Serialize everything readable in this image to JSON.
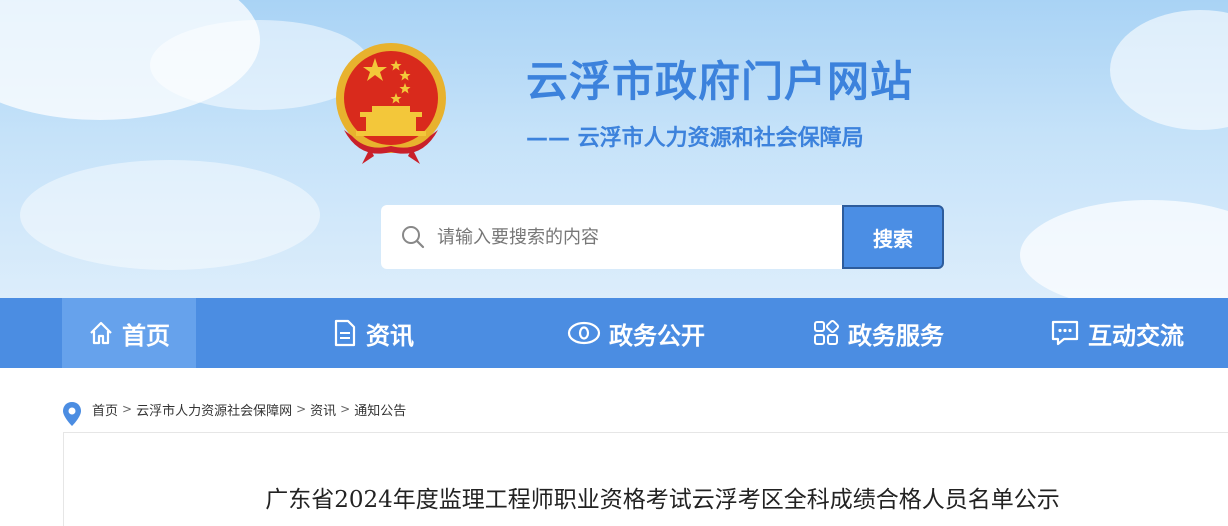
{
  "header": {
    "site_title": "云浮市政府门户网站",
    "site_subtitle": "—— 云浮市人力资源和社会保障局",
    "emblem_icon": "national-emblem-icon"
  },
  "search": {
    "placeholder": "请输入要搜索的内容",
    "value": "",
    "button_label": "搜索",
    "icon": "search-icon"
  },
  "nav": {
    "items": [
      {
        "label": "首页",
        "icon": "home-icon",
        "active": true
      },
      {
        "label": "资讯",
        "icon": "document-icon",
        "active": false
      },
      {
        "label": "政务公开",
        "icon": "eye-icon",
        "active": false
      },
      {
        "label": "政务服务",
        "icon": "grid-icon",
        "active": false
      },
      {
        "label": "互动交流",
        "icon": "chat-icon",
        "active": false
      }
    ]
  },
  "breadcrumb": {
    "icon": "location-pin-icon",
    "items": [
      "首页",
      "云浮市人力资源社会保障网",
      "资讯",
      "通知公告"
    ],
    "separator": ">"
  },
  "article": {
    "title": "广东省2024年度监理工程师职业资格考试云浮考区全科成绩合格人员名单公示"
  },
  "colors": {
    "brand_blue": "#3c82dc",
    "nav_bg": "#4b8de2",
    "nav_active": "#66a2ec",
    "search_button": "#4b8ee4"
  }
}
